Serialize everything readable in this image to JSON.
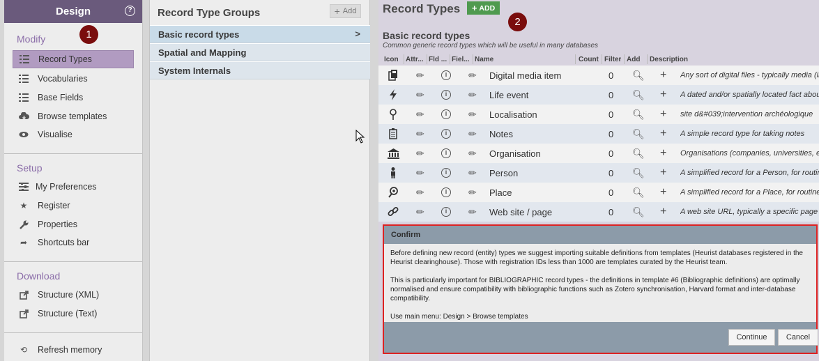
{
  "sidebar": {
    "title": "Design",
    "sections": {
      "modify": "Modify",
      "setup": "Setup",
      "download": "Download"
    },
    "items": [
      {
        "label": "Record Types",
        "icon": "list-icon",
        "active": true
      },
      {
        "label": "Vocabularies",
        "icon": "list-icon"
      },
      {
        "label": "Base Fields",
        "icon": "list-icon"
      },
      {
        "label": "Browse templates",
        "icon": "cloud-download-icon"
      },
      {
        "label": "Visualise",
        "icon": "eye-icon"
      },
      {
        "label": "My Preferences",
        "icon": "preferences-icon"
      },
      {
        "label": "Register",
        "icon": "star-icon"
      },
      {
        "label": "Properties",
        "icon": "wrench-icon"
      },
      {
        "label": "Shortcuts bar",
        "icon": "share-icon"
      },
      {
        "label": "Structure (XML)",
        "icon": "external-link-icon"
      },
      {
        "label": "Structure (Text)",
        "icon": "external-link-icon"
      },
      {
        "label": "Refresh memory",
        "icon": "refresh-icon"
      }
    ]
  },
  "badges": {
    "one": "1",
    "two": "2"
  },
  "groups": {
    "title": "Record Type Groups",
    "add_label": "Add",
    "items": [
      "Basic record types",
      "Spatial and Mapping",
      "System Internals"
    ]
  },
  "types": {
    "title": "Record Types",
    "add_label": "ADD",
    "group_name": "Basic record types",
    "group_desc": "Common generic record types which will be useful in many databases",
    "headers": {
      "icon": "Icon",
      "attr": "Attr...",
      "fld": "Fld ...",
      "fields": "Fiel...",
      "name": "Name",
      "count": "Count",
      "filter": "Filter",
      "add": "Add",
      "description": "Description"
    },
    "rows": [
      {
        "icon": "media-icon",
        "name": "Digital media item",
        "count": "0",
        "desc": "Any sort of digital files - typically media (images, sound, video)"
      },
      {
        "icon": "lightning-icon",
        "name": "Life event",
        "count": "0",
        "desc": "A dated and/or spatially located fact about"
      },
      {
        "icon": "map-pin-icon",
        "name": "Localisation",
        "count": "0",
        "desc": "site d&#039;intervention archéologique"
      },
      {
        "icon": "clipboard-icon",
        "name": "Notes",
        "count": "0",
        "desc": "A simple record type for taking notes"
      },
      {
        "icon": "institution-icon",
        "name": "Organisation",
        "count": "0",
        "desc": "Organisations (companies, universities, etc.)"
      },
      {
        "icon": "person-icon",
        "name": "Person",
        "count": "0",
        "desc": "A simplified record for a Person, for routine use"
      },
      {
        "icon": "place-icon",
        "name": "Place",
        "count": "0",
        "desc": "A simplified record for a Place, for routine use"
      },
      {
        "icon": "link-icon",
        "name": "Web site / page",
        "count": "0",
        "desc": "A web site URL, typically a specific page"
      }
    ]
  },
  "dialog": {
    "title": "Confirm",
    "para1": "Before defining new record (entity) types we suggest importing suitable definitions from templates (Heurist databases registered in the Heurist clearinghouse). Those with registration IDs less than 1000 are templates curated by the Heurist team.",
    "para2": "This is particularly important for BIBLIOGRAPHIC record types - the definitions in template #6 (Bibliographic definitions) are optimally normalised and ensure compatibility with bibliographic functions such as Zotero synchronisation, Harvard format and inter-database compatibility.",
    "para3": "Use main menu: Design > Browse templates",
    "continue_label": "Continue",
    "cancel_label": "Cancel"
  },
  "colors": {
    "sidebar_header": "#6a5a7c",
    "active_item": "#b19bc1",
    "section_heading": "#8a6ca8",
    "add_green": "#4f9a4f",
    "badge": "#7a0d0d",
    "dialog_border": "#dd2222"
  }
}
